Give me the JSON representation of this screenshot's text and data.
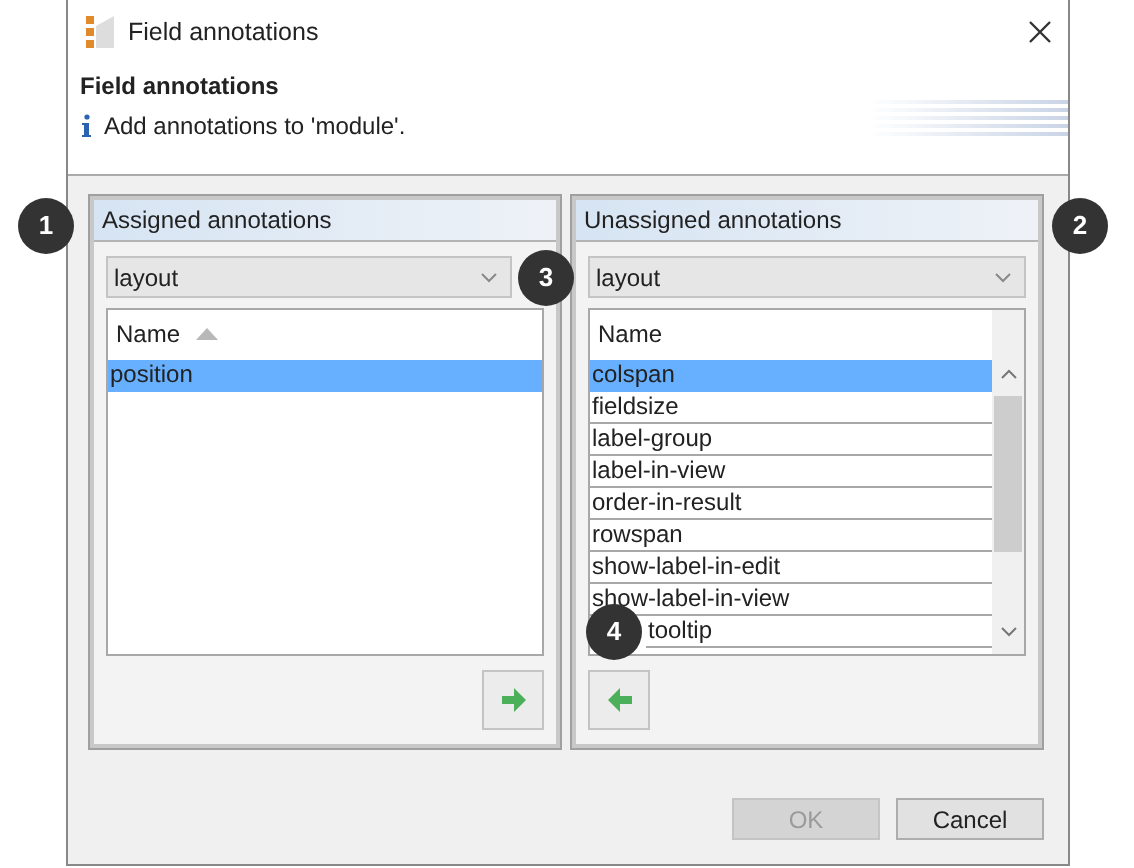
{
  "window": {
    "title": "Field annotations"
  },
  "header": {
    "title": "Field annotations",
    "message": "Add annotations to 'module'."
  },
  "panels": [
    {
      "title": "Assigned annotations",
      "filter": "layout",
      "column": "Name",
      "sorted": true,
      "scrollbar": false,
      "kind": "assigned",
      "items": [
        {
          "label": "position",
          "selected": true,
          "covered": false
        }
      ]
    },
    {
      "title": "Unassigned annotations",
      "filter": "layout",
      "column": "Name",
      "sorted": false,
      "scrollbar": true,
      "kind": "unassigned",
      "items": [
        {
          "label": "colspan",
          "selected": true,
          "covered": false
        },
        {
          "label": "fieldsize",
          "selected": false,
          "covered": false
        },
        {
          "label": "label-group",
          "selected": false,
          "covered": false
        },
        {
          "label": "label-in-view",
          "selected": false,
          "covered": false
        },
        {
          "label": "order-in-result",
          "selected": false,
          "covered": false
        },
        {
          "label": "rowspan",
          "selected": false,
          "covered": false
        },
        {
          "label": "show-label-in-edit",
          "selected": false,
          "covered": false
        },
        {
          "label": "show-label-in-view",
          "selected": false,
          "covered": false
        },
        {
          "label": "tooltip",
          "selected": false,
          "covered": true
        }
      ]
    }
  ],
  "buttons": [
    {
      "label": "OK",
      "disabled": true
    },
    {
      "label": "Cancel",
      "disabled": false
    }
  ],
  "callouts": [
    "1",
    "2",
    "3",
    "4"
  ]
}
